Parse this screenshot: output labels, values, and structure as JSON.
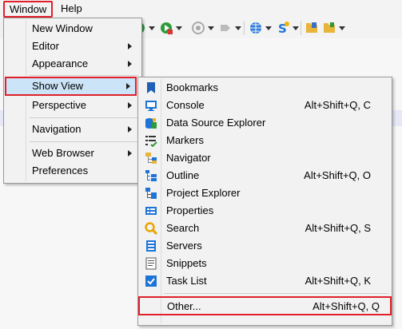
{
  "menubar": {
    "window": "Window",
    "help": "Help"
  },
  "main_menu": {
    "items": [
      {
        "label": "New Window",
        "has_submenu": false
      },
      {
        "label": "Editor",
        "has_submenu": true
      },
      {
        "label": "Appearance",
        "has_submenu": true
      },
      {
        "label": "Show View",
        "has_submenu": true,
        "selected": true
      },
      {
        "label": "Perspective",
        "has_submenu": true
      },
      {
        "label": "Navigation",
        "has_submenu": true
      },
      {
        "label": "Web Browser",
        "has_submenu": true
      },
      {
        "label": "Preferences",
        "has_submenu": false
      }
    ]
  },
  "show_view_menu": {
    "items": [
      {
        "label": "Bookmarks",
        "shortcut": "",
        "icon": "bookmark-icon"
      },
      {
        "label": "Console",
        "shortcut": "Alt+Shift+Q, C",
        "icon": "console-icon"
      },
      {
        "label": "Data Source Explorer",
        "shortcut": "",
        "icon": "database-icon"
      },
      {
        "label": "Markers",
        "shortcut": "",
        "icon": "markers-icon"
      },
      {
        "label": "Navigator",
        "shortcut": "",
        "icon": "navigator-icon"
      },
      {
        "label": "Outline",
        "shortcut": "Alt+Shift+Q, O",
        "icon": "outline-icon"
      },
      {
        "label": "Project Explorer",
        "shortcut": "",
        "icon": "project-explorer-icon"
      },
      {
        "label": "Properties",
        "shortcut": "",
        "icon": "properties-icon"
      },
      {
        "label": "Search",
        "shortcut": "Alt+Shift+Q, S",
        "icon": "search-icon"
      },
      {
        "label": "Servers",
        "shortcut": "",
        "icon": "servers-icon"
      },
      {
        "label": "Snippets",
        "shortcut": "",
        "icon": "snippets-icon"
      },
      {
        "label": "Task List",
        "shortcut": "Alt+Shift+Q, K",
        "icon": "task-list-icon"
      },
      {
        "label": "Other...",
        "shortcut": "Alt+Shift+Q, Q",
        "icon": "",
        "highlighted_box": true
      }
    ]
  },
  "colors": {
    "highlight_border": "#e0202a",
    "selection": "#cce4f7",
    "accent_blue": "#1e74d6"
  }
}
